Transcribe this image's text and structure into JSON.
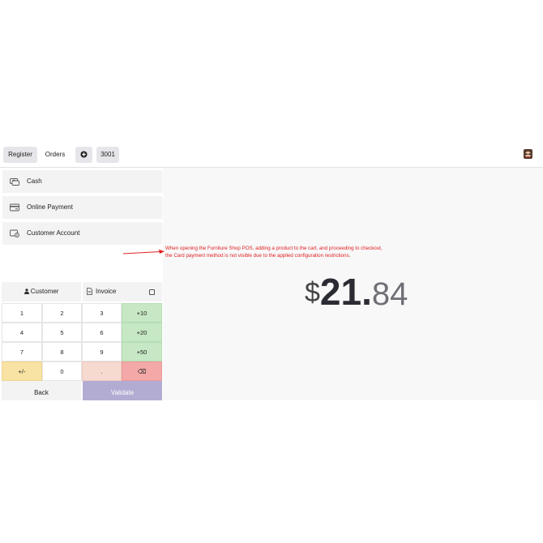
{
  "topbar": {
    "register_label": "Register",
    "orders_label": "Orders",
    "add_order_icon": "plus-circle-icon",
    "order_number": "3001",
    "avatar_icon": "user-avatar-icon"
  },
  "payment_methods": [
    {
      "label": "Cash",
      "icon": "cash-icon"
    },
    {
      "label": "Online Payment",
      "icon": "card-icon"
    },
    {
      "label": "Customer Account",
      "icon": "account-icon"
    }
  ],
  "annotation": {
    "line1": "When opening the Furniture Shop POS, adding a product to the cart, and proceeding to checkout,",
    "line2": "the Card payment method is not visible due to the applied configuration restrictions.",
    "color": "#e01f1f"
  },
  "amount": {
    "currency": "$",
    "integer": "21",
    "decimal_point": ".",
    "cents": "84"
  },
  "customer": {
    "label": "Customer",
    "icon": "person-icon"
  },
  "invoice": {
    "label": "Invoice",
    "icon": "document-icon",
    "checked": false
  },
  "keypad": {
    "rows": [
      [
        "1",
        "2",
        "3",
        "+10"
      ],
      [
        "4",
        "5",
        "6",
        "+20"
      ],
      [
        "7",
        "8",
        "9",
        "+50"
      ],
      [
        "+/-",
        "0",
        ".",
        "⌫"
      ]
    ]
  },
  "back_label": "Back",
  "validate_label": "Validate",
  "colors": {
    "quick_add": "#c6e8c4",
    "sign": "#f8e3a4",
    "decimal": "#f6d9cf",
    "backspace": "#f4a8a8",
    "validate": "#b3acd2"
  }
}
